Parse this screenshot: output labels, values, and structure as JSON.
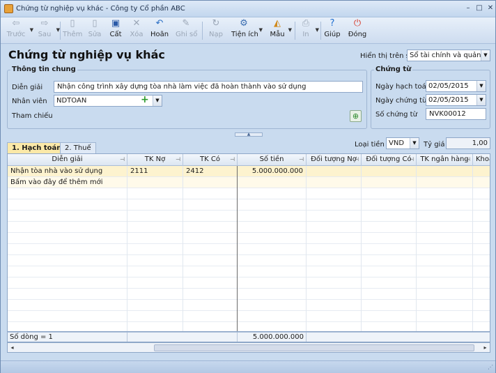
{
  "window": {
    "title": "Chứng từ nghiệp vụ khác - Công ty Cổ phần ABC"
  },
  "toolbar": {
    "items": [
      {
        "label": "Trước",
        "icon": "arrow-left-icon",
        "enabled": false
      },
      {
        "label": "Sau",
        "icon": "arrow-right-icon",
        "enabled": false
      },
      {
        "label": "Thêm",
        "icon": "add-document-icon",
        "enabled": false
      },
      {
        "label": "Sửa",
        "icon": "edit-document-icon",
        "enabled": false
      },
      {
        "label": "Cất",
        "icon": "save-icon",
        "enabled": true
      },
      {
        "label": "Xóa",
        "icon": "delete-icon",
        "enabled": false
      },
      {
        "label": "Hoãn",
        "icon": "undo-icon",
        "enabled": true
      },
      {
        "label": "Ghi sổ",
        "icon": "post-ledger-icon",
        "enabled": false
      },
      {
        "label": "Nạp",
        "icon": "reload-icon",
        "enabled": false
      },
      {
        "label": "Tiện ích",
        "icon": "utilities-icon",
        "enabled": true
      },
      {
        "label": "Mẫu",
        "icon": "template-icon",
        "enabled": true
      },
      {
        "label": "In",
        "icon": "print-icon",
        "enabled": false
      },
      {
        "label": "Giúp",
        "icon": "help-icon",
        "enabled": true
      },
      {
        "label": "Đóng",
        "icon": "close-icon",
        "enabled": true
      }
    ]
  },
  "heading": "Chứng từ nghiệp vụ khác",
  "display_on_book": {
    "label": "Hiển thị trên sổ",
    "value": "Sổ tài chính và quản trị"
  },
  "general_info": {
    "title": "Thông tin chung",
    "description_label": "Diễn giải",
    "description_value": "Nhận công trình xây dựng tòa nhà làm việc đã hoàn thành vào sử dụng",
    "employee_label": "Nhân viên",
    "employee_value": "NDTOAN",
    "reference_label": "Tham chiếu"
  },
  "voucher": {
    "title": "Chứng từ",
    "posting_date_label": "Ngày hạch toán",
    "posting_date_value": "02/05/2015",
    "voucher_date_label": "Ngày chứng từ",
    "voucher_date_value": "02/05/2015",
    "voucher_no_label": "Số chứng từ",
    "voucher_no_value": "NVK00012"
  },
  "tabs": [
    {
      "label": "1. Hạch toán",
      "active": true
    },
    {
      "label": "2. Thuế",
      "active": false
    }
  ],
  "currency": {
    "label": "Loại tiền",
    "value": "VND",
    "rate_label": "Tỷ giá",
    "rate_value": "1,00"
  },
  "grid": {
    "columns": [
      "Diễn giải",
      "TK Nợ",
      "TK Có",
      "Số tiền",
      "Đối tượng Nợ",
      "Đối tượng Có",
      "TK ngân hàng",
      "Khoả"
    ],
    "rows": [
      [
        "Nhận tòa nhà vào sử dụng",
        "2111",
        "2412",
        "5.000.000.000",
        "",
        "",
        "",
        ""
      ]
    ],
    "new_row_text": "Bấm vào đây để thêm mới",
    "footer_count": "Số dòng = 1",
    "footer_total": "5.000.000.000"
  }
}
